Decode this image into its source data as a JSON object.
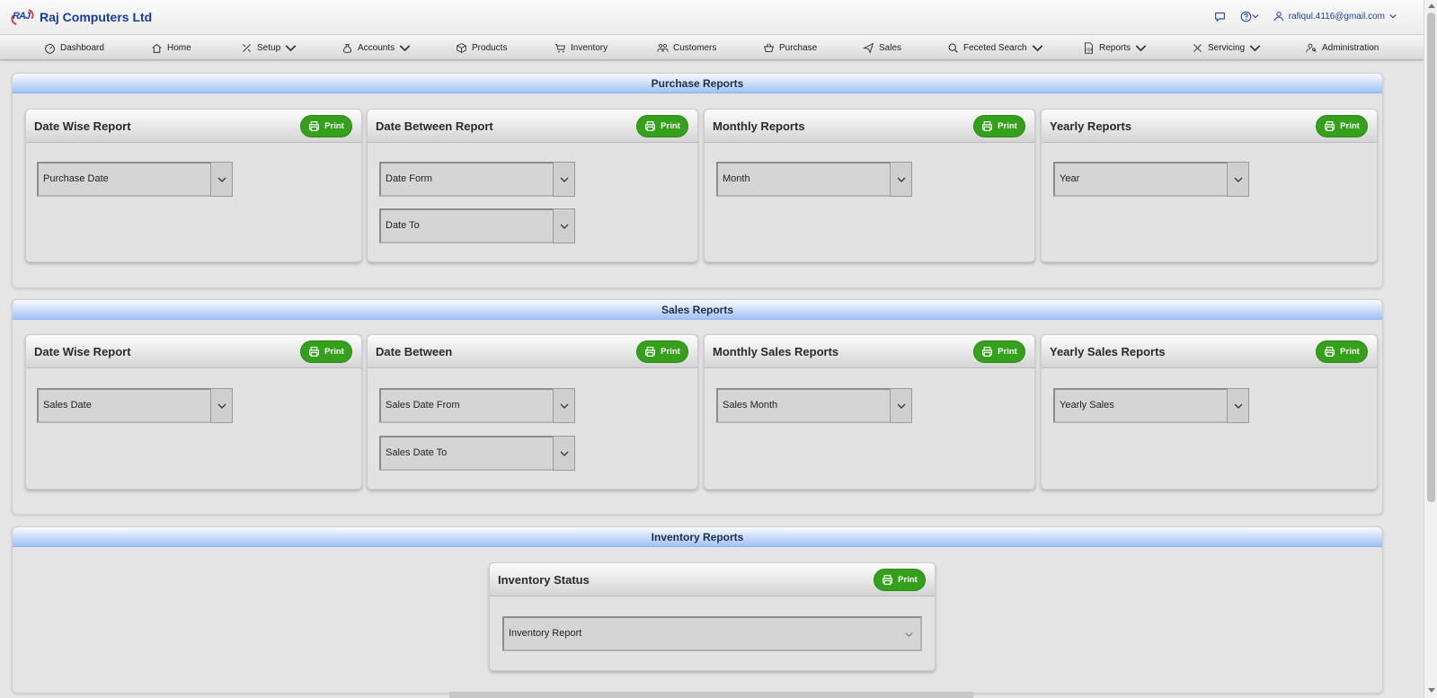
{
  "header": {
    "brand_logo_text": "RAJ",
    "brand_name": "Raj Computers Ltd",
    "user_email": "rafiqul.4116@gmail.com"
  },
  "nav": [
    {
      "label": "Dashboard",
      "icon": "gauge-icon",
      "dropdown": false
    },
    {
      "label": "Home",
      "icon": "home-icon",
      "dropdown": false
    },
    {
      "label": "Setup",
      "icon": "tools-icon",
      "dropdown": true
    },
    {
      "label": "Accounts",
      "icon": "money-bag-icon",
      "dropdown": true
    },
    {
      "label": "Products",
      "icon": "box-icon",
      "dropdown": false
    },
    {
      "label": "Inventory",
      "icon": "cart-icon",
      "dropdown": false
    },
    {
      "label": "Customers",
      "icon": "people-icon",
      "dropdown": false
    },
    {
      "label": "Purchase",
      "icon": "basket-icon",
      "dropdown": false
    },
    {
      "label": "Sales",
      "icon": "send-icon",
      "dropdown": false
    },
    {
      "label": "Feceted Search",
      "icon": "search-icon",
      "dropdown": true
    },
    {
      "label": "Reports",
      "icon": "pdf-icon",
      "dropdown": true
    },
    {
      "label": "Servicing",
      "icon": "wrench-icon",
      "dropdown": true
    },
    {
      "label": "Administration",
      "icon": "user-gear-icon",
      "dropdown": false
    }
  ],
  "print_label": "Print",
  "purchase": {
    "title": "Purchase Reports",
    "cards": [
      {
        "title": "Date Wise Report",
        "fields": [
          "Purchase Date"
        ]
      },
      {
        "title": "Date Between Report",
        "fields": [
          "Date Form",
          "Date To"
        ]
      },
      {
        "title": "Monthly Reports",
        "fields": [
          "Month"
        ]
      },
      {
        "title": "Yearly Reports",
        "fields": [
          "Year"
        ]
      }
    ]
  },
  "sales": {
    "title": "Sales Reports",
    "cards": [
      {
        "title": "Date Wise Report",
        "fields": [
          "Sales Date"
        ]
      },
      {
        "title": "Date Between",
        "fields": [
          "Sales Date From",
          "Sales Date To"
        ]
      },
      {
        "title": "Monthly Sales Reports",
        "fields": [
          "Sales Month"
        ]
      },
      {
        "title": "Yearly Sales Reports",
        "fields": [
          "Yearly Sales"
        ]
      }
    ]
  },
  "inventory": {
    "title": "Inventory Reports",
    "card": {
      "title": "Inventory Status",
      "field": "Inventory Report"
    }
  },
  "colors": {
    "brand": "#173c9c",
    "print_button": "#35a01b",
    "section_header": "#9fc2f5"
  }
}
